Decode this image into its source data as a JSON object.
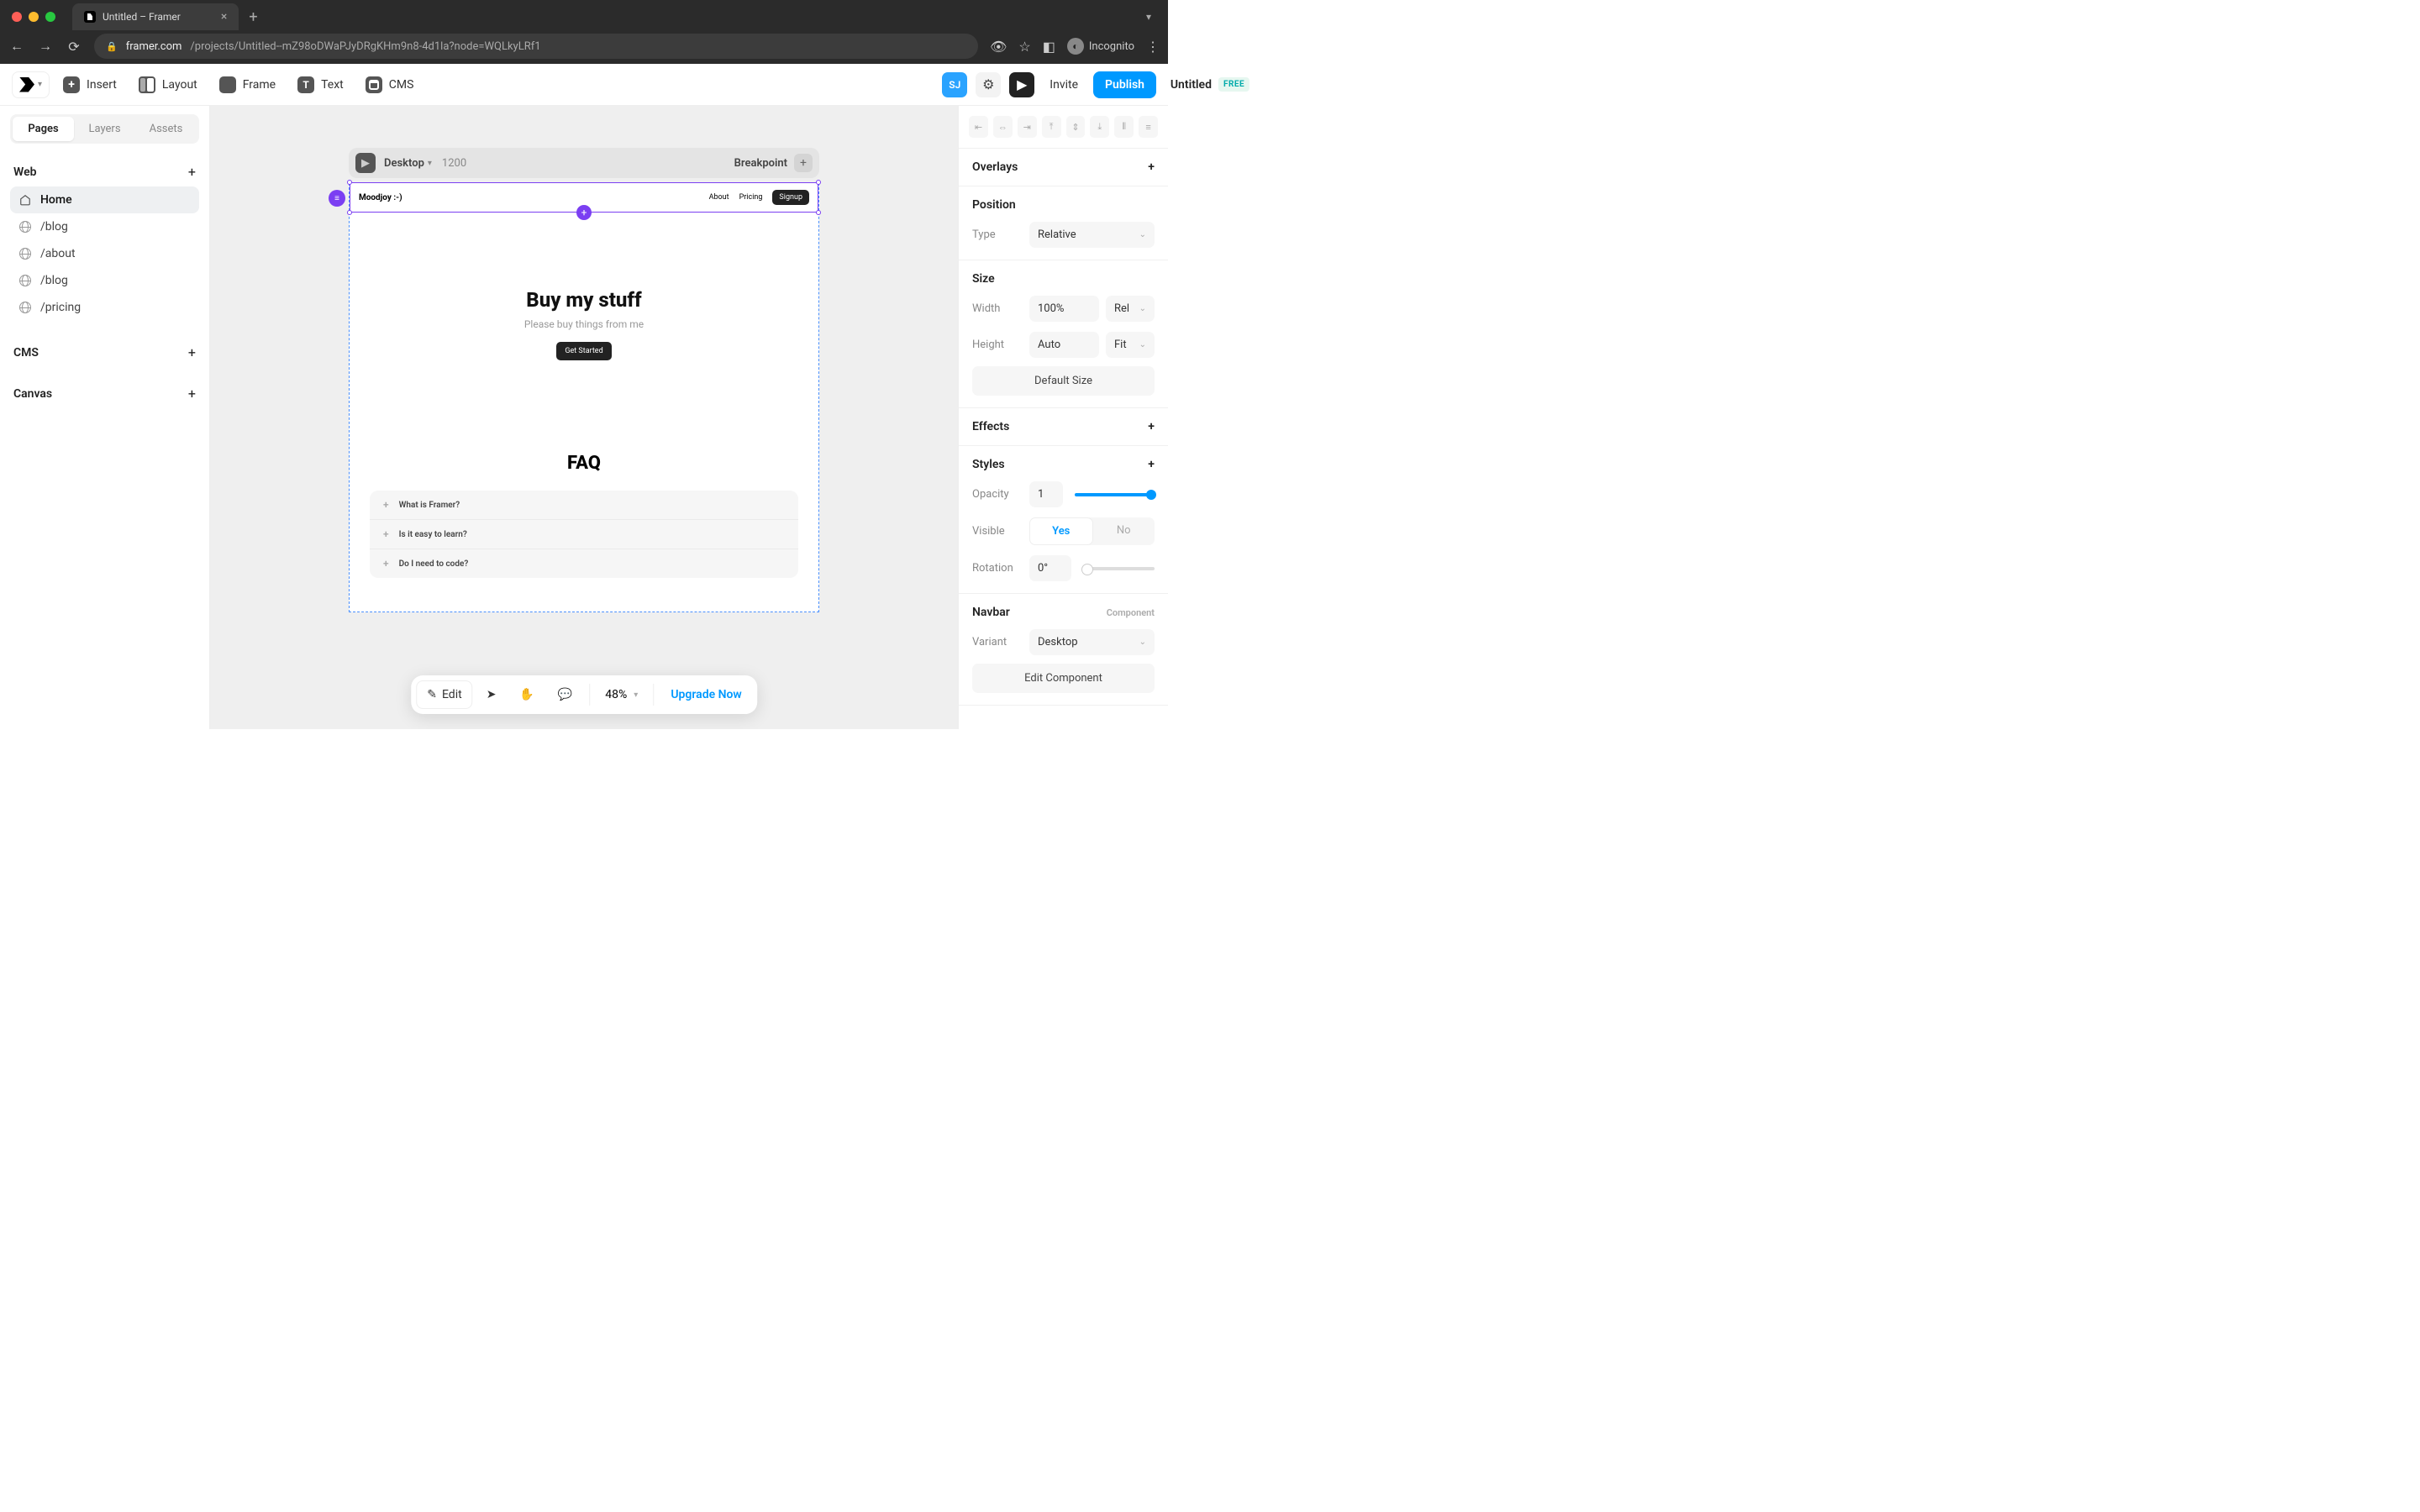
{
  "browser": {
    "tab_title": "Untitled – Framer",
    "url_host": "framer.com",
    "url_path": "/projects/Untitled--mZ98oDWaPJyDRgKHm9n8-4d1la?node=WQLkyLRf1",
    "incognito_label": "Incognito"
  },
  "toolbar": {
    "insert": "Insert",
    "layout": "Layout",
    "frame": "Frame",
    "text": "Text",
    "cms": "CMS",
    "title": "Untitled",
    "badge": "FREE",
    "avatar": "SJ",
    "invite": "Invite",
    "publish": "Publish"
  },
  "left": {
    "tabs": [
      "Pages",
      "Layers",
      "Assets"
    ],
    "web_header": "Web",
    "pages": [
      {
        "icon": "home",
        "label": "Home",
        "active": true
      },
      {
        "icon": "globe",
        "label": "/blog"
      },
      {
        "icon": "globe",
        "label": "/about"
      },
      {
        "icon": "globe",
        "label": "/blog"
      },
      {
        "icon": "globe",
        "label": "/pricing"
      }
    ],
    "cms_header": "CMS",
    "canvas_header": "Canvas"
  },
  "breakpoint_bar": {
    "device": "Desktop",
    "width": "1200",
    "label": "Breakpoint"
  },
  "artboard": {
    "nav": {
      "logo": "Moodjoy :-)",
      "links": [
        "About",
        "Pricing"
      ],
      "signup": "Signup"
    },
    "hero": {
      "title": "Buy my stuff",
      "subtitle": "Please buy things from me",
      "cta": "Get Started"
    },
    "faq": {
      "title": "FAQ",
      "items": [
        "What is Framer?",
        "Is it easy to learn?",
        "Do I need to code?"
      ]
    }
  },
  "floatbar": {
    "edit": "Edit",
    "zoom": "48%",
    "upgrade": "Upgrade Now"
  },
  "right": {
    "overlays": "Overlays",
    "position": {
      "header": "Position",
      "type_label": "Type",
      "type_value": "Relative"
    },
    "size": {
      "header": "Size",
      "width_label": "Width",
      "width_value": "100%",
      "width_unit": "Rel",
      "height_label": "Height",
      "height_value": "Auto",
      "height_unit": "Fit",
      "default": "Default Size"
    },
    "effects": "Effects",
    "styles": {
      "header": "Styles",
      "opacity_label": "Opacity",
      "opacity_value": "1",
      "visible_label": "Visible",
      "yes": "Yes",
      "no": "No",
      "rotation_label": "Rotation",
      "rotation_value": "0°"
    },
    "navbar": {
      "header": "Navbar",
      "tag": "Component",
      "variant_label": "Variant",
      "variant_value": "Desktop",
      "edit_component": "Edit Component"
    }
  }
}
